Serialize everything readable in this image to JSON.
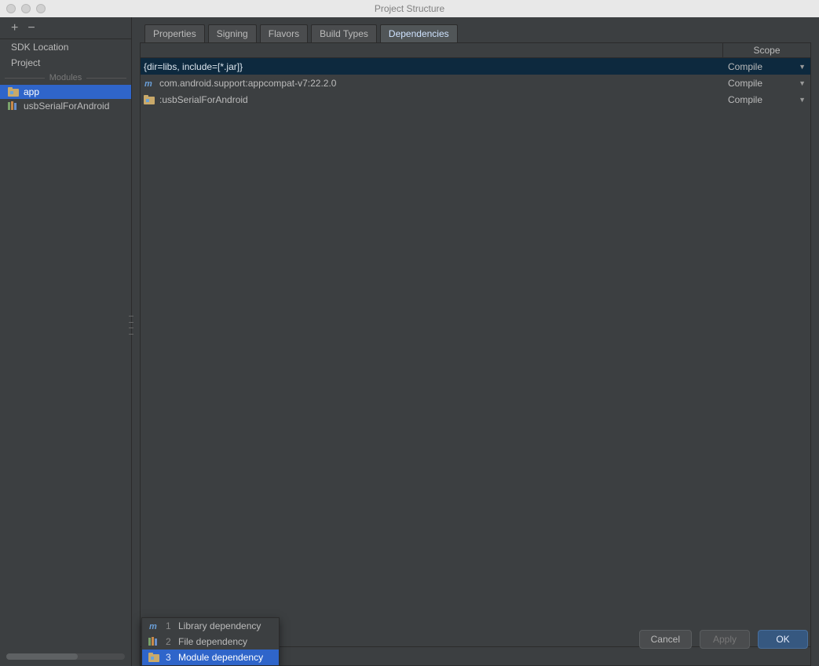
{
  "window": {
    "title": "Project Structure"
  },
  "sidebar": {
    "items": [
      "SDK Location",
      "Project"
    ],
    "modules_header": "Modules",
    "modules": [
      {
        "name": "app",
        "selected": true,
        "icon": "module-folder-icon"
      },
      {
        "name": "usbSerialForAndroid",
        "selected": false,
        "icon": "module-lib-icon"
      }
    ]
  },
  "tabs": {
    "items": [
      "Properties",
      "Signing",
      "Flavors",
      "Build Types",
      "Dependencies"
    ],
    "active": "Dependencies"
  },
  "table": {
    "scope_header": "Scope",
    "rows": [
      {
        "label": "{dir=libs, include=[*.jar]}",
        "scope": "Compile",
        "selected": true,
        "icon": null
      },
      {
        "label": "com.android.support:appcompat-v7:22.2.0",
        "scope": "Compile",
        "selected": false,
        "icon": "maven-icon"
      },
      {
        "label": ":usbSerialForAndroid",
        "scope": "Compile",
        "selected": false,
        "icon": "module-folder-icon"
      }
    ]
  },
  "popup": {
    "items": [
      {
        "num": "1",
        "label": "Library dependency",
        "icon": "maven-icon",
        "selected": false
      },
      {
        "num": "2",
        "label": "File dependency",
        "icon": "module-lib-icon",
        "selected": false
      },
      {
        "num": "3",
        "label": "Module dependency",
        "icon": "module-folder-icon",
        "selected": true
      }
    ]
  },
  "buttons": {
    "cancel": "Cancel",
    "apply": "Apply",
    "ok": "OK"
  }
}
